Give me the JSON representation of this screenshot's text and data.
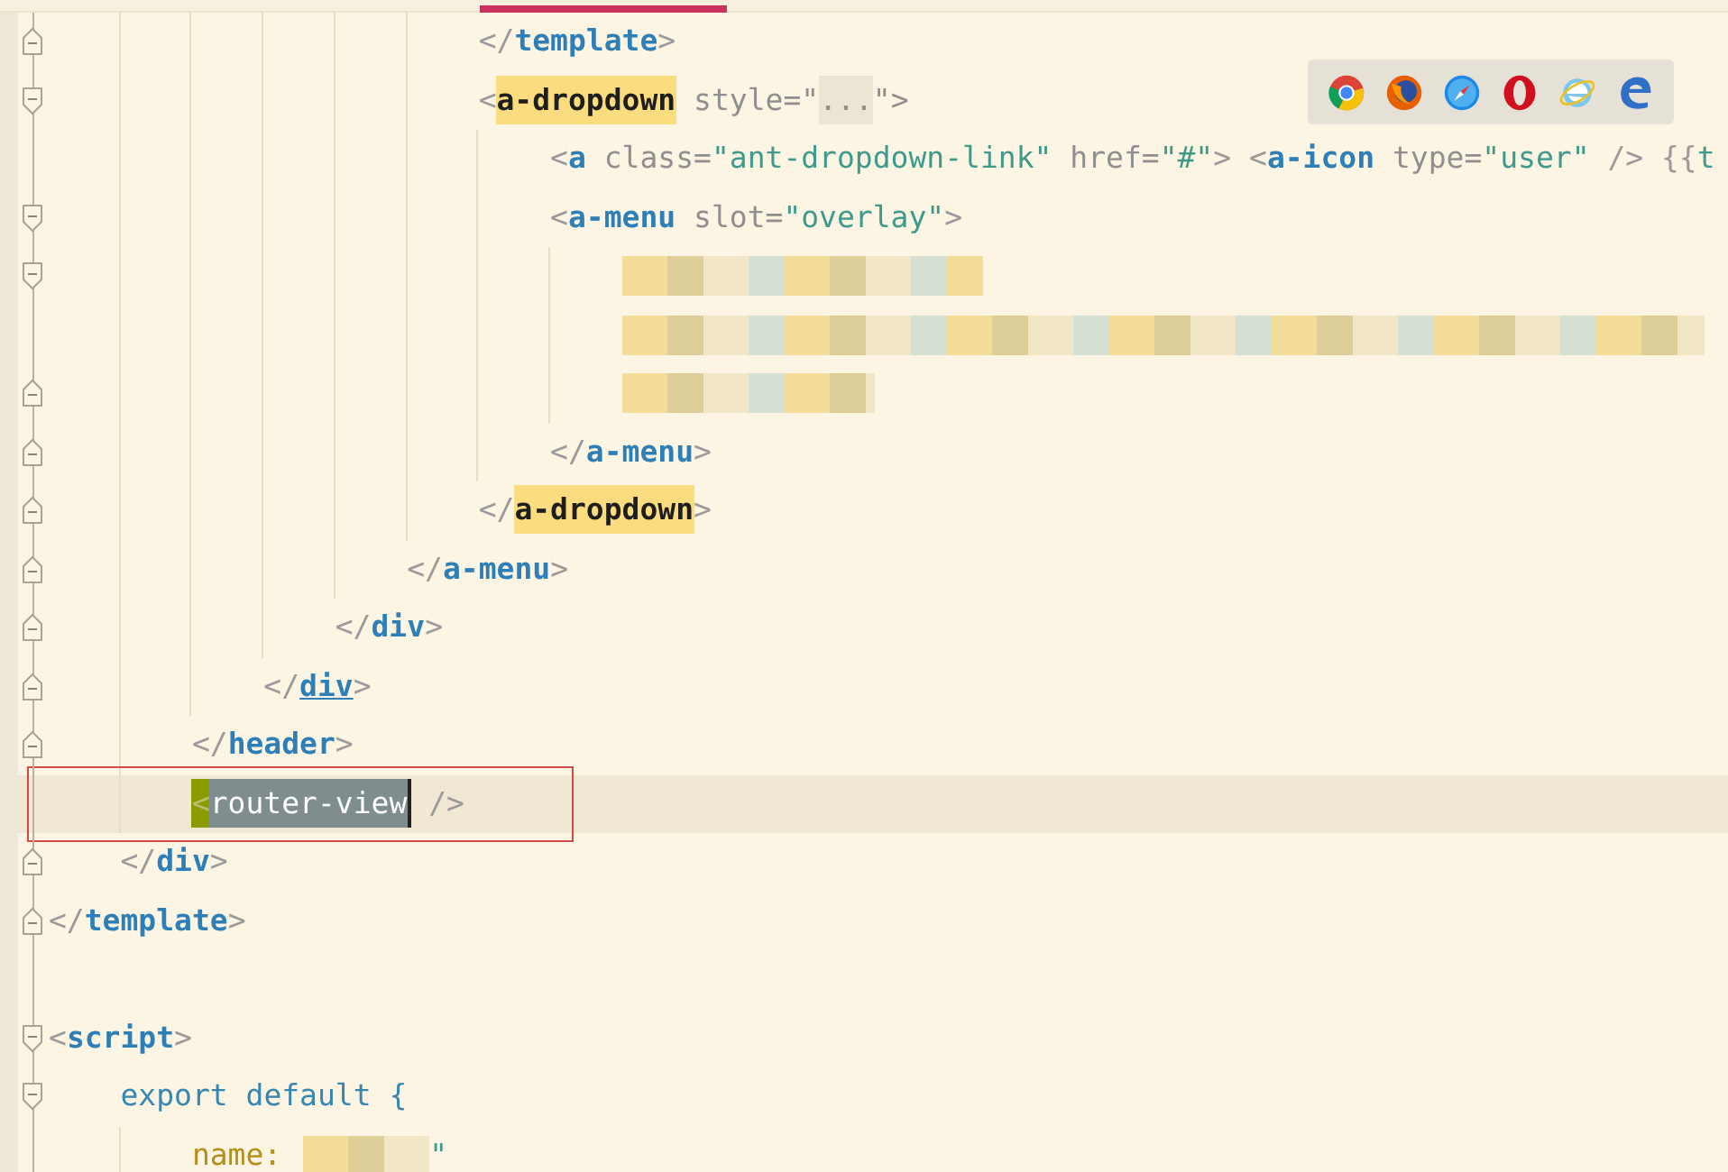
{
  "browser_bar": {
    "icons": [
      {
        "kind": "chrome"
      },
      {
        "kind": "firefox"
      },
      {
        "kind": "safari"
      },
      {
        "kind": "opera"
      },
      {
        "kind": "ie"
      },
      {
        "kind": "edge"
      }
    ]
  },
  "lines": [
    {
      "children": [
        {
          "children": [
            {
              "children": [
                {
                  "children": [
                    {
                      "children": [
                        {
                          "children": [
                            {
                              "kind": "code",
                              "fold_end": true,
                              "tokens": [
                                {
                                  "text": "</",
                                  "kind": "bracket"
                                },
                                {
                                  "text": "template",
                                  "kind": "tag"
                                },
                                {
                                  "text": ">",
                                  "kind": "bracket"
                                }
                              ]
                            },
                            {
                              "kind": "code",
                              "fold_start": true,
                              "tokens": [
                                {
                                  "text": "<",
                                  "kind": "bracket"
                                },
                                {
                                  "text": "a-dropdown",
                                  "kind": "tag",
                                  "highlighted": true
                                },
                                {
                                  "text": " style=\"",
                                  "kind": "attr"
                                },
                                {
                                  "text": "...",
                                  "kind": "folded"
                                },
                                {
                                  "text": "\">",
                                  "kind": "attr"
                                }
                              ],
                              "children": [
                                {
                                  "kind": "code",
                                  "tokens": [
                                    {
                                      "text": "<",
                                      "kind": "bracket"
                                    },
                                    {
                                      "text": "a",
                                      "kind": "tag"
                                    },
                                    {
                                      "text": " class=",
                                      "kind": "attr"
                                    },
                                    {
                                      "text": "\"ant-dropdown-link\"",
                                      "kind": "string"
                                    },
                                    {
                                      "text": " href=",
                                      "kind": "attr"
                                    },
                                    {
                                      "text": "\"#\"",
                                      "kind": "string"
                                    },
                                    {
                                      "text": "> <",
                                      "kind": "bracket"
                                    },
                                    {
                                      "text": "a-icon",
                                      "kind": "tag"
                                    },
                                    {
                                      "text": " type=",
                                      "kind": "attr"
                                    },
                                    {
                                      "text": "\"user\"",
                                      "kind": "string"
                                    },
                                    {
                                      "text": " /> {{",
                                      "kind": "bracket"
                                    },
                                    {
                                      "text": "t",
                                      "kind": "string"
                                    }
                                  ]
                                },
                                {
                                  "kind": "code",
                                  "fold_start": true,
                                  "tokens": [
                                    {
                                      "text": "<",
                                      "kind": "bracket"
                                    },
                                    {
                                      "text": "a-menu",
                                      "kind": "tag"
                                    },
                                    {
                                      "text": " slot=",
                                      "kind": "attr"
                                    },
                                    {
                                      "text": "\"overlay\"",
                                      "kind": "string"
                                    },
                                    {
                                      "text": ">",
                                      "kind": "bracket"
                                    }
                                  ],
                                  "children": [
                                    {
                                      "kind": "code",
                                      "fold_start": true,
                                      "tokens": [
                                        {
                                          "kind": "redacted"
                                        }
                                      ]
                                    },
                                    {
                                      "kind": "code",
                                      "tokens": [
                                        {
                                          "kind": "redacted"
                                        }
                                      ]
                                    },
                                    {
                                      "kind": "code",
                                      "fold_end": true,
                                      "tokens": [
                                        {
                                          "kind": "redacted"
                                        }
                                      ]
                                    }
                                  ]
                                },
                                {
                                  "kind": "code",
                                  "fold_end": true,
                                  "tokens": [
                                    {
                                      "text": "</",
                                      "kind": "bracket"
                                    },
                                    {
                                      "text": "a-menu",
                                      "kind": "tag"
                                    },
                                    {
                                      "text": ">",
                                      "kind": "bracket"
                                    }
                                  ]
                                }
                              ]
                            },
                            {
                              "kind": "code",
                              "fold_end": true,
                              "tokens": [
                                {
                                  "text": "</",
                                  "kind": "bracket"
                                },
                                {
                                  "text": "a-dropdown",
                                  "kind": "tag",
                                  "highlighted": true
                                },
                                {
                                  "text": ">",
                                  "kind": "bracket"
                                }
                              ]
                            }
                          ]
                        },
                        {
                          "kind": "code",
                          "fold_end": true,
                          "tokens": [
                            {
                              "text": "</",
                              "kind": "bracket"
                            },
                            {
                              "text": "a-menu",
                              "kind": "tag"
                            },
                            {
                              "text": ">",
                              "kind": "bracket"
                            }
                          ]
                        }
                      ]
                    },
                    {
                      "kind": "code",
                      "fold_end": true,
                      "tokens": [
                        {
                          "text": "</",
                          "kind": "bracket"
                        },
                        {
                          "text": "div",
                          "kind": "tag"
                        },
                        {
                          "text": ">",
                          "kind": "bracket"
                        }
                      ]
                    }
                  ]
                },
                {
                  "kind": "code",
                  "fold_end": true,
                  "tokens": [
                    {
                      "text": "</",
                      "kind": "bracket"
                    },
                    {
                      "text": "div",
                      "kind": "tag",
                      "underlined": true
                    },
                    {
                      "text": ">",
                      "kind": "bracket"
                    }
                  ]
                }
              ]
            },
            {
              "kind": "code",
              "fold_end": true,
              "tokens": [
                {
                  "text": "</",
                  "kind": "bracket"
                },
                {
                  "text": "header",
                  "kind": "tag"
                },
                {
                  "text": ">",
                  "kind": "bracket"
                }
              ]
            },
            {
              "kind": "code",
              "current": true,
              "boxed": true,
              "tokens": [
                {
                  "text": "<",
                  "kind": "bracket",
                  "matched": true
                },
                {
                  "text": "router-view",
                  "kind": "tag",
                  "selected": true
                },
                {
                  "text": " />",
                  "kind": "bracket"
                }
              ]
            }
          ]
        },
        {
          "kind": "code",
          "fold_end": true,
          "tokens": [
            {
              "text": "</",
              "kind": "bracket"
            },
            {
              "text": "div",
              "kind": "tag"
            },
            {
              "text": ">",
              "kind": "bracket"
            }
          ]
        }
      ]
    },
    {
      "kind": "code",
      "fold_end": true,
      "tokens": [
        {
          "text": "</",
          "kind": "bracket"
        },
        {
          "text": "template",
          "kind": "tag"
        },
        {
          "text": ">",
          "kind": "bracket"
        }
      ]
    },
    {
      "kind": "blank"
    },
    {
      "kind": "code",
      "fold_start": true,
      "tokens": [
        {
          "text": "<",
          "kind": "bracket"
        },
        {
          "text": "script",
          "kind": "tag"
        },
        {
          "text": ">",
          "kind": "bracket"
        }
      ],
      "children": [
        {
          "kind": "code",
          "fold_start": true,
          "tokens": [
            {
              "text": "export default {",
              "kind": "keyword"
            }
          ],
          "children": [
            {
              "kind": "code",
              "tokens": [
                {
                  "text": "name:",
                  "kind": "property"
                },
                {
                  "kind": "redacted"
                },
                {
                  "text": "\"",
                  "kind": "string"
                }
              ]
            }
          ]
        }
      ]
    }
  ]
}
